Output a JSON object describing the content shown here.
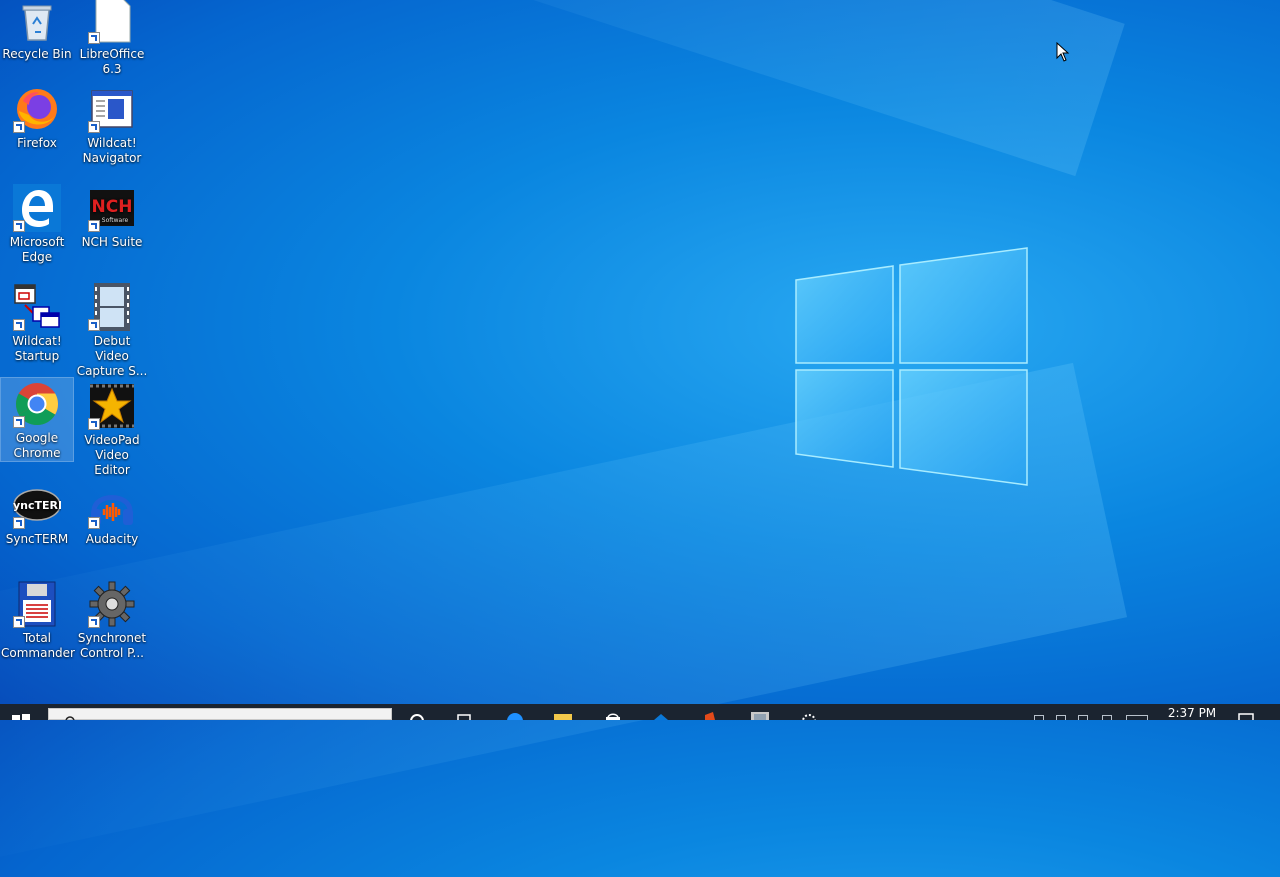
{
  "desktop": {
    "icons": [
      {
        "label": "Recycle Bin"
      },
      {
        "label": "LibreOffice 6.3"
      },
      {
        "label": "Firefox"
      },
      {
        "label": "Wildcat! Navigator"
      },
      {
        "label": "Microsoft Edge"
      },
      {
        "label": "NCH Suite"
      },
      {
        "label": "Wildcat! Startup"
      },
      {
        "label": "Debut Video Capture S..."
      },
      {
        "label": "Google Chrome"
      },
      {
        "label": "VideoPad Video Editor"
      },
      {
        "label": "SyncTERM"
      },
      {
        "label": "Audacity"
      },
      {
        "label": "Total Commander"
      },
      {
        "label": "Synchronet Control P..."
      }
    ],
    "selected": "Google Chrome",
    "nch_logo_text": "NCH",
    "nch_logo_subtext": "Software",
    "syncterm_logo_text": "SyncTERM"
  },
  "taskbar": {
    "clock": "2:37 PM",
    "pinned_icons": [
      "task-view-icon",
      "edge-icon",
      "file-explorer-icon",
      "store-icon",
      "mail-icon",
      "office-icon",
      "app-icon",
      "gear-icon"
    ]
  },
  "colors": {
    "accent": "#0a86e0",
    "taskbar": "#1b2430"
  }
}
